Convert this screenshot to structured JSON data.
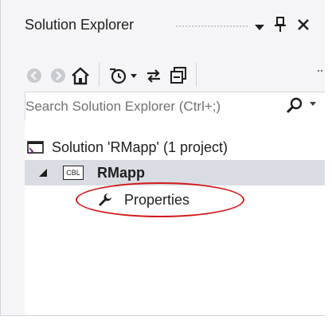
{
  "panel": {
    "title": "Solution Explorer",
    "title_icons": [
      "dropdown-arrow-icon",
      "pin-icon",
      "close-icon"
    ]
  },
  "toolbar": {
    "icons": [
      "back-icon",
      "forward-icon",
      "home-icon",
      "pending-changes-filter-icon",
      "sync-icon",
      "collapse-all-icon"
    ]
  },
  "search": {
    "placeholder": "Search Solution Explorer (Ctrl+;)"
  },
  "tree": {
    "solution_label": "Solution 'RMapp' (1 project)",
    "project_label": "RMapp",
    "project_badge": "CBL",
    "properties_label": "Properties"
  },
  "colors": {
    "highlight_ellipse": "#d11b1b",
    "selection": "#d9dce3"
  }
}
